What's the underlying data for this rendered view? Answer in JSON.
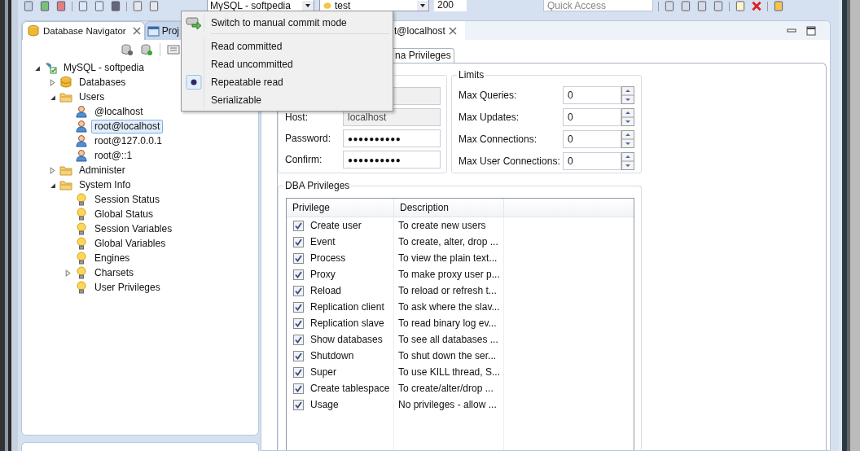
{
  "toolbar": {
    "connection": "MySQL - softpedia",
    "database": "test",
    "result_limit": "200",
    "quick_access": {
      "placeholder": "Quick Access"
    }
  },
  "navigator": {
    "tabs": [
      {
        "label": "Database Navigator",
        "selected": true,
        "closable": true
      },
      {
        "label": "Proj",
        "selected": false,
        "closable": false
      }
    ],
    "tree": [
      {
        "kind": "connection",
        "label": "MySQL - softpedia",
        "selected": false,
        "expanded": true,
        "children": [
          {
            "kind": "database",
            "label": "Databases",
            "selected": false,
            "expanded": false
          },
          {
            "kind": "folder",
            "label": "Users",
            "selected": false,
            "expanded": true,
            "children": [
              {
                "kind": "user",
                "label": "@localhost",
                "selected": false
              },
              {
                "kind": "user",
                "label": "root@localhost",
                "selected": true
              },
              {
                "kind": "user",
                "label": "root@127.0.0.1",
                "selected": false
              },
              {
                "kind": "user",
                "label": "root@::1",
                "selected": false
              }
            ]
          },
          {
            "kind": "folder",
            "label": "Administer",
            "selected": false,
            "expanded": false
          },
          {
            "kind": "folder",
            "label": "System Info",
            "selected": false,
            "expanded": true,
            "children": [
              {
                "kind": "info",
                "label": "Session Status",
                "selected": false
              },
              {
                "kind": "info",
                "label": "Global Status",
                "selected": false
              },
              {
                "kind": "info",
                "label": "Session Variables",
                "selected": false
              },
              {
                "kind": "info",
                "label": "Global Variables",
                "selected": false
              },
              {
                "kind": "info",
                "label": "Engines",
                "selected": false
              },
              {
                "kind": "info",
                "label": "Charsets",
                "selected": false,
                "expanded": false
              },
              {
                "kind": "info",
                "label": "User Privileges",
                "selected": false
              }
            ]
          }
        ]
      }
    ]
  },
  "editor": {
    "tab": {
      "label": "t@localhost"
    },
    "subtab": {
      "label": "na Privileges"
    },
    "account": {
      "fields": [
        {
          "disabled": true
        },
        {
          "label": "Host:",
          "value": "localhost",
          "disabled": true
        },
        {
          "label": "Password:",
          "value": "●●●●●●●●●●",
          "disabled": false
        },
        {
          "label": "Confirm:",
          "value": "●●●●●●●●●●",
          "disabled": false
        }
      ]
    },
    "limits": {
      "title": "Limits",
      "fields": [
        {
          "label": "Max Queries:",
          "value": "0"
        },
        {
          "label": "Max Updates:",
          "value": "0"
        },
        {
          "label": "Max Connections:",
          "value": "0"
        },
        {
          "label": "Max User Connections:",
          "value": "0"
        }
      ]
    },
    "dba_privileges": {
      "title": "DBA Privileges",
      "columns": [
        "Privilege",
        "Description"
      ],
      "rows": [
        {
          "privilege": "Create user",
          "description": "To create new users",
          "checked": true
        },
        {
          "privilege": "Event",
          "description": "To create, alter, drop ...",
          "checked": true
        },
        {
          "privilege": "Process",
          "description": "To view the plain text...",
          "checked": true
        },
        {
          "privilege": "Proxy",
          "description": "To make proxy user p...",
          "checked": true
        },
        {
          "privilege": "Reload",
          "description": "To reload or refresh t...",
          "checked": true
        },
        {
          "privilege": "Replication client",
          "description": "To ask where the slav...",
          "checked": true
        },
        {
          "privilege": "Replication slave",
          "description": "To read binary log ev...",
          "checked": true
        },
        {
          "privilege": "Show databases",
          "description": "To see all databases ...",
          "checked": true
        },
        {
          "privilege": "Shutdown",
          "description": "To shut down the ser...",
          "checked": true
        },
        {
          "privilege": "Super",
          "description": "To use KILL thread, S...",
          "checked": true
        },
        {
          "privilege": "Create tablespace",
          "description": "To create/alter/drop ...",
          "checked": true
        },
        {
          "privilege": "Usage",
          "description": "No privileges - allow ...",
          "checked": true
        }
      ]
    }
  },
  "menu": {
    "command": {
      "label": "Switch to manual commit mode"
    },
    "isolation_levels": [
      {
        "label": "Read committed",
        "selected": false
      },
      {
        "label": "Read uncommitted",
        "selected": false
      },
      {
        "label": "Repeatable read",
        "selected": true
      },
      {
        "label": "Serializable",
        "selected": false
      }
    ]
  }
}
